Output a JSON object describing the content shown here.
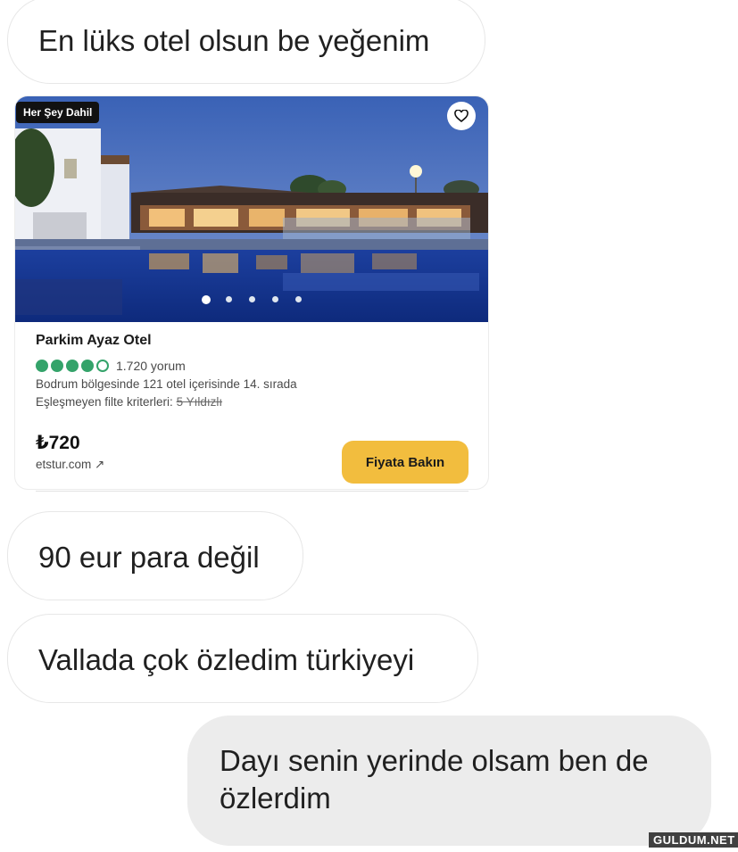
{
  "messages": {
    "m1": "En lüks otel olsun be yeğenim",
    "m2": "90 eur para değil",
    "m3": "Vallada çok özledim türkiyeyi",
    "m4_line1": "Dayı senin yerinde olsam ben de",
    "m4_line2": "özlerdim"
  },
  "hotel_card": {
    "badge": "Her Şey Dahil",
    "name": "Parkim Ayaz Otel",
    "rating": 4,
    "rating_max": 5,
    "reviews": "1.720 yorum",
    "rank_text": "Bodrum bölgesinde 121 otel içerisinde 14. sırada",
    "mismatch_label": "Eşleşmeyen filte kriterleri:",
    "mismatch_value": "5 Yıldızlı",
    "price": "₺720",
    "site": "etstur.com ↗",
    "cta": "Fiyata Bakın",
    "photo_count": 5,
    "photo_active_index": 0
  },
  "colors": {
    "rating_green": "#34a36a",
    "cta_yellow": "#f2bd3e",
    "outgoing_bubble": "#ececec"
  },
  "watermark": "GULDUM.NET"
}
